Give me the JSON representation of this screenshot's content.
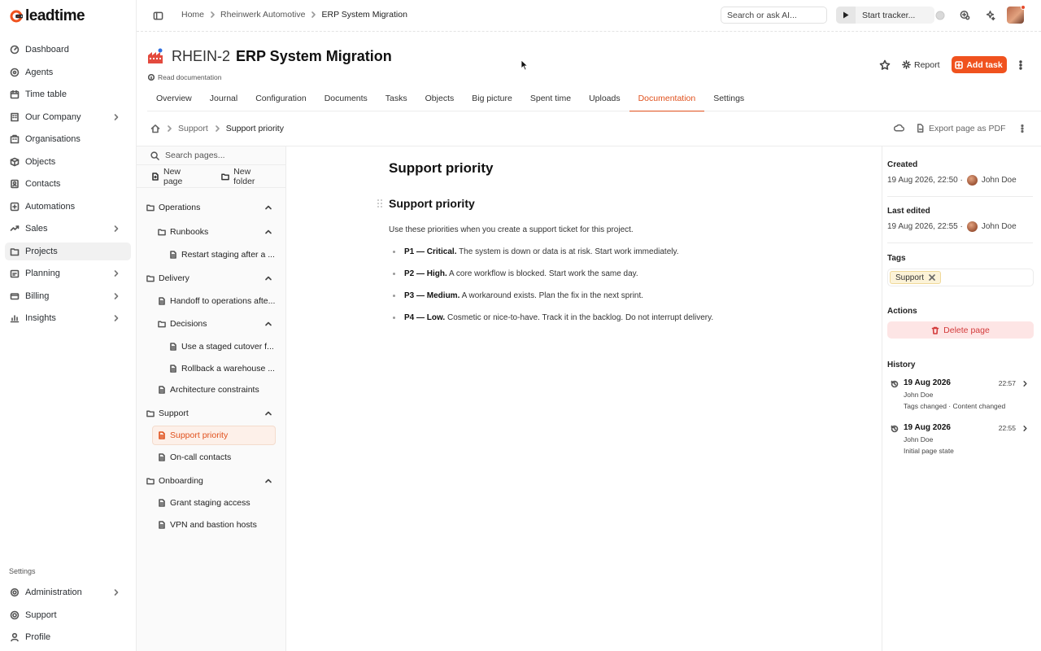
{
  "app": {
    "logo_text": "leadtime",
    "brand_color": "#f0521e"
  },
  "sidebar": {
    "items": [
      {
        "label": "Dashboard",
        "icon": "gauge-icon",
        "chevron": false
      },
      {
        "label": "Agents",
        "icon": "agents-icon",
        "chevron": false
      },
      {
        "label": "Time table",
        "icon": "calendar-icon",
        "chevron": false
      },
      {
        "label": "Our Company",
        "icon": "building-icon",
        "chevron": true
      },
      {
        "label": "Organisations",
        "icon": "org-icon",
        "chevron": false
      },
      {
        "label": "Objects",
        "icon": "box-icon",
        "chevron": false
      },
      {
        "label": "Contacts",
        "icon": "contacts-icon",
        "chevron": false
      },
      {
        "label": "Automations",
        "icon": "automation-icon",
        "chevron": false
      },
      {
        "label": "Sales",
        "icon": "sales-icon",
        "chevron": true
      },
      {
        "label": "Projects",
        "icon": "projects-icon",
        "chevron": false,
        "active": true
      },
      {
        "label": "Planning",
        "icon": "planning-icon",
        "chevron": true
      },
      {
        "label": "Billing",
        "icon": "billing-icon",
        "chevron": true
      },
      {
        "label": "Insights",
        "icon": "insights-icon",
        "chevron": true
      }
    ],
    "settings_label": "Settings",
    "bottom_items": [
      {
        "label": "Administration",
        "icon": "gear-icon",
        "chevron": true
      },
      {
        "label": "Support",
        "icon": "support-icon",
        "chevron": false
      },
      {
        "label": "Profile",
        "icon": "user-icon",
        "chevron": false
      }
    ]
  },
  "topbar": {
    "breadcrumb": [
      "Home",
      "Rheinwerk Automotive",
      "ERP System Migration"
    ],
    "search_placeholder": "Search or ask AI...",
    "tracker_label": "Start tracker..."
  },
  "project": {
    "code": "RHEIN-2",
    "title": "ERP System Migration",
    "read_doc": "Read documentation",
    "report_label": "Report",
    "add_task_label": "Add task"
  },
  "tabs": [
    {
      "label": "Overview"
    },
    {
      "label": "Journal"
    },
    {
      "label": "Configuration"
    },
    {
      "label": "Documents"
    },
    {
      "label": "Tasks"
    },
    {
      "label": "Objects"
    },
    {
      "label": "Big picture"
    },
    {
      "label": "Spent time"
    },
    {
      "label": "Uploads"
    },
    {
      "label": "Documentation",
      "active": true
    },
    {
      "label": "Settings"
    }
  ],
  "doc_toolbar": {
    "breadcrumb": [
      "Support",
      "Support priority"
    ],
    "export_label": "Export page as PDF"
  },
  "tree": {
    "search_placeholder": "Search pages...",
    "new_page": "New page",
    "new_folder": "New folder",
    "rows": [
      {
        "label": "Operations",
        "type": "folder",
        "level": 0,
        "caret": true
      },
      {
        "label": "Runbooks",
        "type": "folder",
        "level": 1,
        "caret": true
      },
      {
        "label": "Restart staging after a ...",
        "type": "page",
        "level": 2
      },
      {
        "label": "Delivery",
        "type": "folder",
        "level": 0,
        "caret": true
      },
      {
        "label": "Handoff to operations afte...",
        "type": "page",
        "level": 1
      },
      {
        "label": "Decisions",
        "type": "folder",
        "level": 1,
        "caret": true
      },
      {
        "label": "Use a staged cutover f...",
        "type": "page",
        "level": 2
      },
      {
        "label": "Rollback a warehouse ...",
        "type": "page",
        "level": 2
      },
      {
        "label": "Architecture constraints",
        "type": "page",
        "level": 1
      },
      {
        "label": "Support",
        "type": "folder",
        "level": 0,
        "caret": true
      },
      {
        "label": "Support priority",
        "type": "page",
        "level": 1,
        "selected": true
      },
      {
        "label": "On-call contacts",
        "type": "page",
        "level": 1
      },
      {
        "label": "Onboarding",
        "type": "folder",
        "level": 0,
        "caret": true
      },
      {
        "label": "Grant staging access",
        "type": "page",
        "level": 1
      },
      {
        "label": "VPN and bastion hosts",
        "type": "page",
        "level": 1
      }
    ]
  },
  "page": {
    "h1": "Support priority",
    "h2": "Support priority",
    "intro": "Use these priorities when you create a support ticket for this project.",
    "bullets": [
      {
        "bold": "P1 — Critical.",
        "text": " The system is down or data is at risk. Start work immediately."
      },
      {
        "bold": "P2 — High.",
        "text": " A core workflow is blocked. Start work the same day."
      },
      {
        "bold": "P3 — Medium.",
        "text": " A workaround exists. Plan the fix in the next sprint."
      },
      {
        "bold": "P4 — Low.",
        "text": " Cosmetic or nice-to-have. Track it in the backlog. Do not interrupt delivery."
      }
    ]
  },
  "meta": {
    "created_label": "Created",
    "created_value": "19 Aug 2026, 22:50 ·",
    "created_by": "John Doe",
    "edited_label": "Last edited",
    "edited_value": "19 Aug 2026, 22:55 ·",
    "edited_by": "John Doe",
    "tags_label": "Tags",
    "tag": "Support",
    "actions_label": "Actions",
    "delete_label": "Delete page",
    "history_label": "History",
    "history": [
      {
        "date": "19 Aug 2026",
        "time": "22:57",
        "by": "John Doe",
        "desc": "Tags changed · Content changed"
      },
      {
        "date": "19 Aug 2026",
        "time": "22:55",
        "by": "John Doe",
        "desc": "Initial page state"
      }
    ]
  }
}
